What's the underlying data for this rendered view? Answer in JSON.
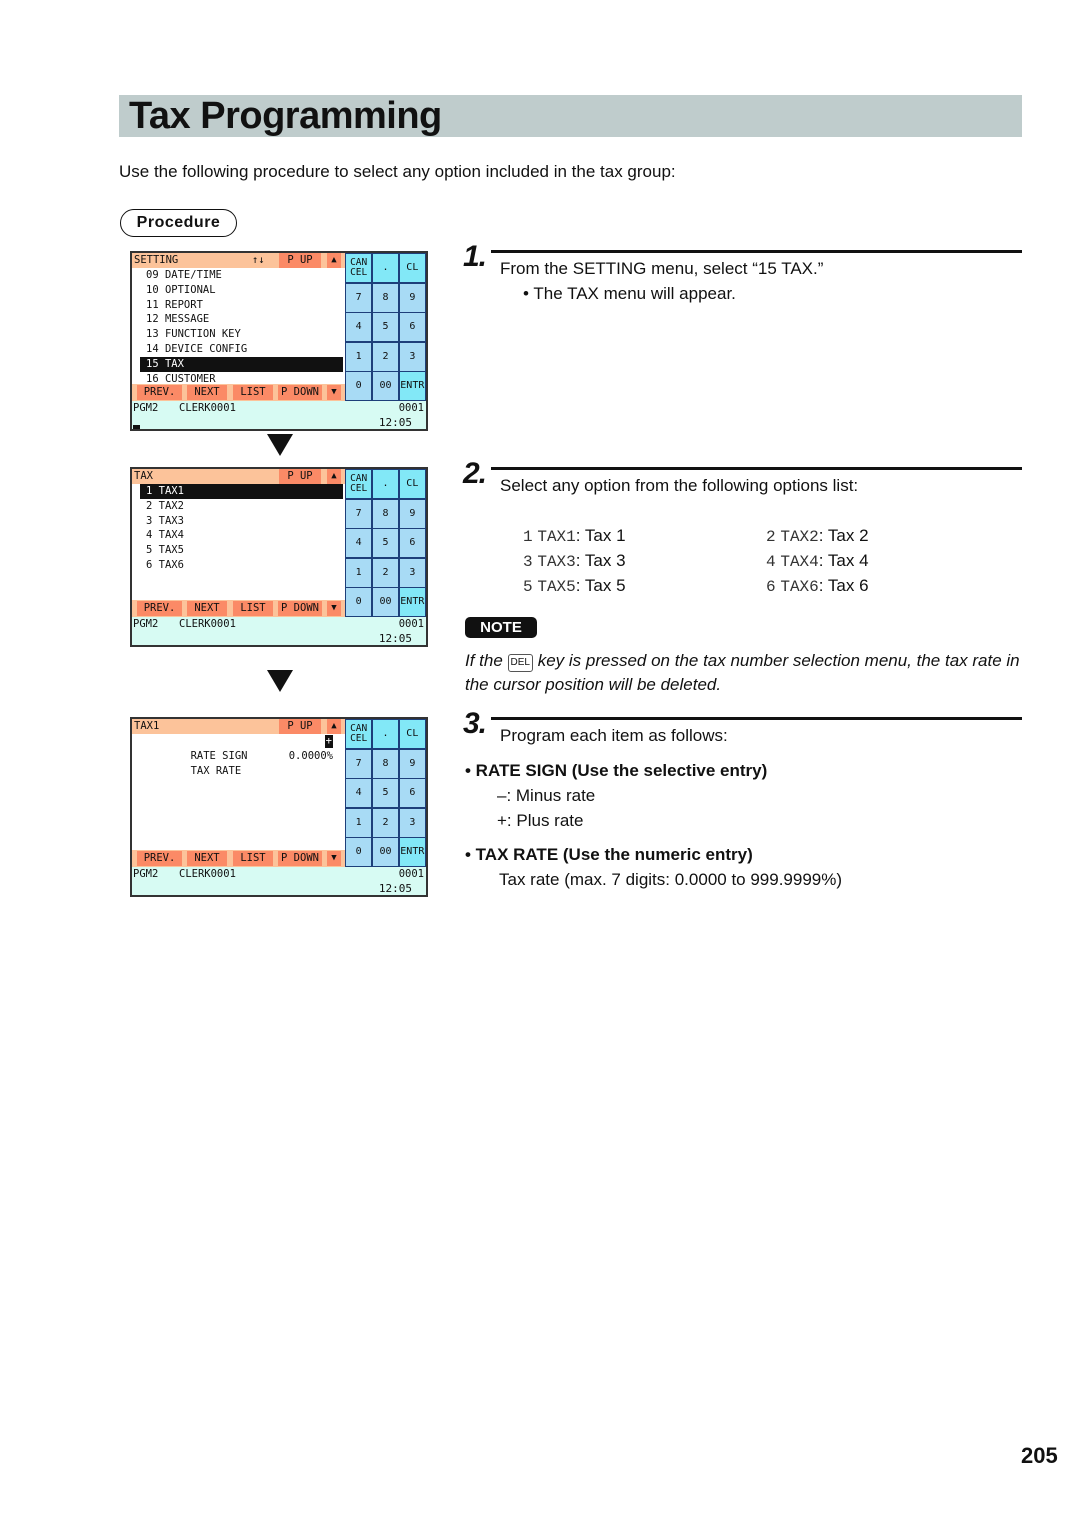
{
  "page": {
    "title": "Tax Programming",
    "intro": "Use the following procedure to select any option included in the tax group:",
    "procedure_label": "Procedure",
    "page_number": "205"
  },
  "screens": [
    {
      "header": "SETTING",
      "sort_icon": "↑↓",
      "page_up": "P UP",
      "up_icon": "▲",
      "rows": [
        "09 DATE/TIME",
        "10 OPTIONAL",
        "11 REPORT",
        "12 MESSAGE",
        "13 FUNCTION KEY",
        "14 DEVICE CONFIG",
        "15 TAX",
        "16 CUSTOMER"
      ],
      "selected_row": 6
    },
    {
      "header": "TAX",
      "page_up": "P UP",
      "up_icon": "▲",
      "rows": [
        "1 TAX1",
        "2 TAX2",
        "3 TAX3",
        "4 TAX4",
        "5 TAX5",
        "6 TAX6"
      ],
      "selected_row": 0
    },
    {
      "header": "TAX1",
      "page_up": "P UP",
      "up_icon": "▲",
      "fields": [
        {
          "label": "RATE SIGN",
          "value": "+"
        },
        {
          "label": "TAX RATE",
          "value": "0.0000%"
        }
      ]
    }
  ],
  "screen_common": {
    "footer_buttons": [
      "PREV.",
      "NEXT",
      "LIST",
      "P DOWN"
    ],
    "down_icon": "▼",
    "status": {
      "mode": "PGM2",
      "clerk": "CLERK0001",
      "number": "0001",
      "time": "12:05"
    },
    "keypad": [
      "CAN CEL",
      ".",
      "CL",
      "7",
      "8",
      "9",
      "4",
      "5",
      "6",
      "1",
      "2",
      "3",
      "0",
      "00",
      "ENTR"
    ]
  },
  "steps": [
    {
      "number": "1.",
      "text": "From the SETTING menu, select “15 TAX.”",
      "sub": "• The TAX menu will appear."
    },
    {
      "number": "2.",
      "text": "Select any option from the following options list:",
      "options": [
        {
          "n": "1",
          "code": "TAX1",
          "label": "Tax 1"
        },
        {
          "n": "2",
          "code": "TAX2",
          "label": "Tax 2"
        },
        {
          "n": "3",
          "code": "TAX3",
          "label": "Tax 3"
        },
        {
          "n": "4",
          "code": "TAX4",
          "label": "Tax 4"
        },
        {
          "n": "5",
          "code": "TAX5",
          "label": "Tax 5"
        },
        {
          "n": "6",
          "code": "TAX6",
          "label": "Tax 6"
        }
      ],
      "note_label": "NOTE",
      "note_pre": "If the ",
      "note_key": "DEL",
      "note_post": " key is pressed on the tax number selection menu, the tax rate in the cursor position will be deleted."
    },
    {
      "number": "3.",
      "text": "Program each item as follows:",
      "items": [
        {
          "heading": "• RATE SIGN (Use the selective entry)",
          "lines": [
            "–: Minus rate",
            "+: Plus rate"
          ]
        },
        {
          "heading": "• TAX RATE (Use the numeric entry)",
          "lines": [
            "Tax rate (max. 7 digits: 0.0000 to 999.9999%)"
          ]
        }
      ]
    }
  ]
}
